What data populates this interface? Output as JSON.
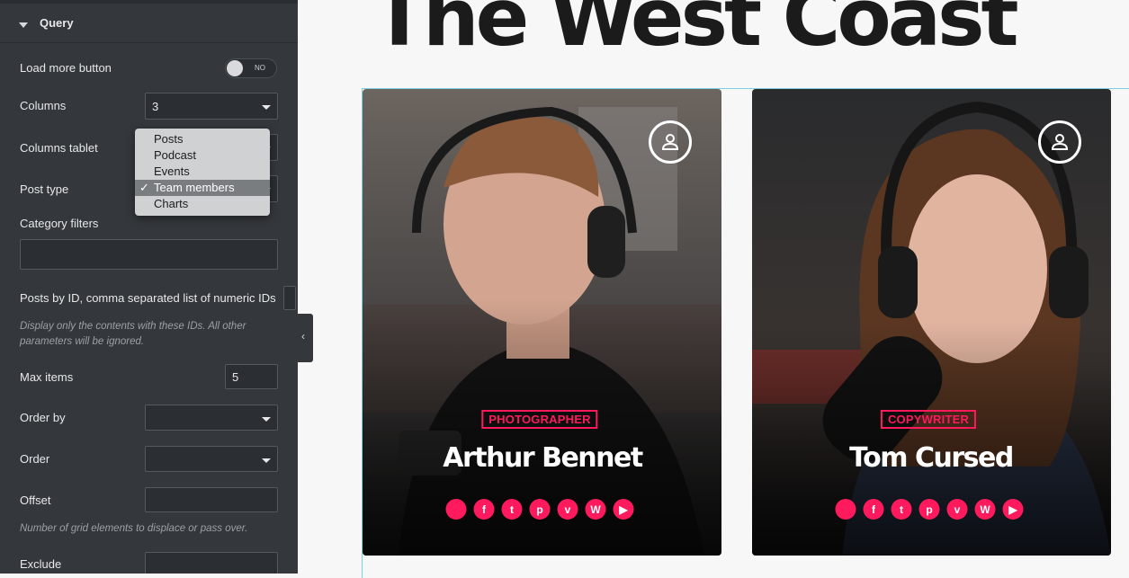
{
  "panel": {
    "section_title": "Query",
    "load_more": {
      "label": "Load more button",
      "toggle_text": "NO"
    },
    "columns": {
      "label": "Columns",
      "value": "3"
    },
    "columns_tablet": {
      "label": "Columns tablet"
    },
    "post_type": {
      "label": "Post type",
      "options": [
        "Posts",
        "Podcast",
        "Events",
        "Team members",
        "Charts"
      ],
      "selected": "Team members"
    },
    "category_filters": {
      "label": "Category filters"
    },
    "posts_by_id": {
      "label": "Posts by ID, comma separated list of numeric IDs",
      "note": "Display only the contents with these IDs. All other parameters will be ignored."
    },
    "max_items": {
      "label": "Max items",
      "value": "5"
    },
    "order_by": {
      "label": "Order by"
    },
    "order": {
      "label": "Order"
    },
    "offset": {
      "label": "Offset",
      "note": "Number of grid elements to displace or pass over."
    },
    "exclude": {
      "label": "Exclude"
    }
  },
  "page": {
    "headline": "The West Coast",
    "cards": [
      {
        "role": "PHOTOGRAPHER",
        "name": "Arthur Bennet"
      },
      {
        "role": "COPYWRITER",
        "name": "Tom Cursed"
      }
    ],
    "social_icons": [
      "apple-icon",
      "facebook-icon",
      "twitter-icon",
      "pinterest-icon",
      "vimeo-icon",
      "wordpress-icon",
      "youtube-icon"
    ]
  },
  "colors": {
    "accent": "#ff1a5e",
    "panel_bg": "#34383c",
    "selection_guide": "#7fd0e0"
  }
}
